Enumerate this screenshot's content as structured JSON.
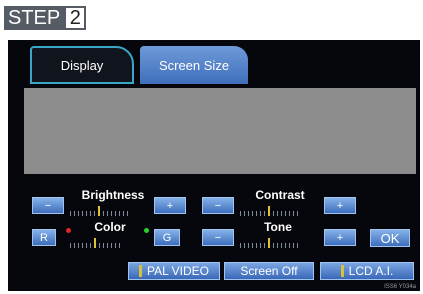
{
  "step": {
    "word": "STEP",
    "number": "2"
  },
  "tabs": [
    {
      "label": "Display",
      "active": true
    },
    {
      "label": "Screen Size",
      "active": false
    }
  ],
  "controls": {
    "brightness": {
      "label": "Brightness",
      "minus": "−",
      "plus": "+"
    },
    "contrast": {
      "label": "Contrast",
      "minus": "−",
      "plus": "+"
    },
    "color": {
      "label": "Color",
      "left": "R",
      "right": "G",
      "left_dot_color": "#e02828",
      "right_dot_color": "#28d028"
    },
    "tone": {
      "label": "Tone",
      "minus": "−",
      "plus": "+"
    }
  },
  "ok_label": "OK",
  "bottom_buttons": [
    {
      "label": "PAL VIDEO",
      "indicator": true
    },
    {
      "label": "Screen Off",
      "indicator": false
    },
    {
      "label": "LCD A.I.",
      "indicator": true
    }
  ],
  "caption": "ISS6 Y034a"
}
